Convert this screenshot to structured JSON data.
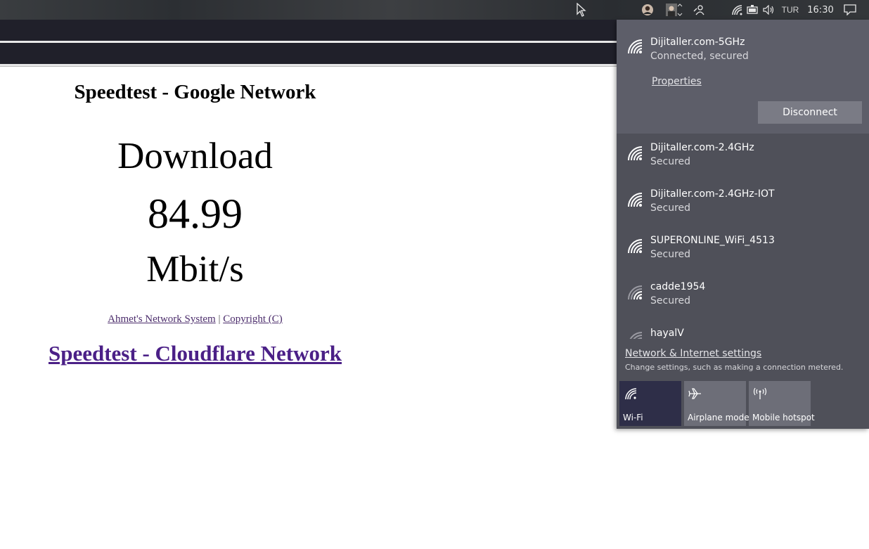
{
  "taskbar": {
    "language": "TUR",
    "time": "16:30",
    "icons": [
      "avatar-icon",
      "profile-photo-icon",
      "tray-chevron-icon",
      "people-icon",
      "wifi-icon",
      "battery-icon",
      "volume-icon",
      "action-center-icon"
    ]
  },
  "page": {
    "title": "Speedtest - Google Network",
    "download_label": "Download",
    "download_value": "84.99",
    "download_unit": "Mbit/s",
    "footer_link1": "Ahmet's Network System",
    "footer_separator": "|",
    "footer_link2": "Copyright (C)",
    "cloudflare_link": "Speedtest - Cloudflare Network"
  },
  "flyout": {
    "connected": {
      "name": "Dijitaller.com-5GHz",
      "status": "Connected, secured",
      "properties_label": "Properties",
      "disconnect_label": "Disconnect"
    },
    "networks": [
      {
        "name": "Dijitaller.com-2.4GHz",
        "status": "Secured"
      },
      {
        "name": "Dijitaller.com-2.4GHz-IOT",
        "status": "Secured"
      },
      {
        "name": "SUPERONLINE_WiFi_4513",
        "status": "Secured"
      },
      {
        "name": "cadde1954",
        "status": "Secured"
      },
      {
        "name": "hayalV",
        "status": ""
      }
    ],
    "settings_link": "Network & Internet settings",
    "settings_desc": "Change settings, such as making a connection metered.",
    "quick_actions": [
      {
        "label": "Wi-Fi",
        "icon": "wifi-icon",
        "active": true
      },
      {
        "label": "Airplane mode",
        "icon": "airplane-icon",
        "active": false
      },
      {
        "label": "Mobile hotspot",
        "icon": "hotspot-icon",
        "active": false
      }
    ]
  },
  "colors": {
    "flyout_bg": "#4f5059",
    "connected_bg": "#5d5e69",
    "wifi_tile_active": "#2e2e48",
    "link_visited": "#4b2087"
  }
}
